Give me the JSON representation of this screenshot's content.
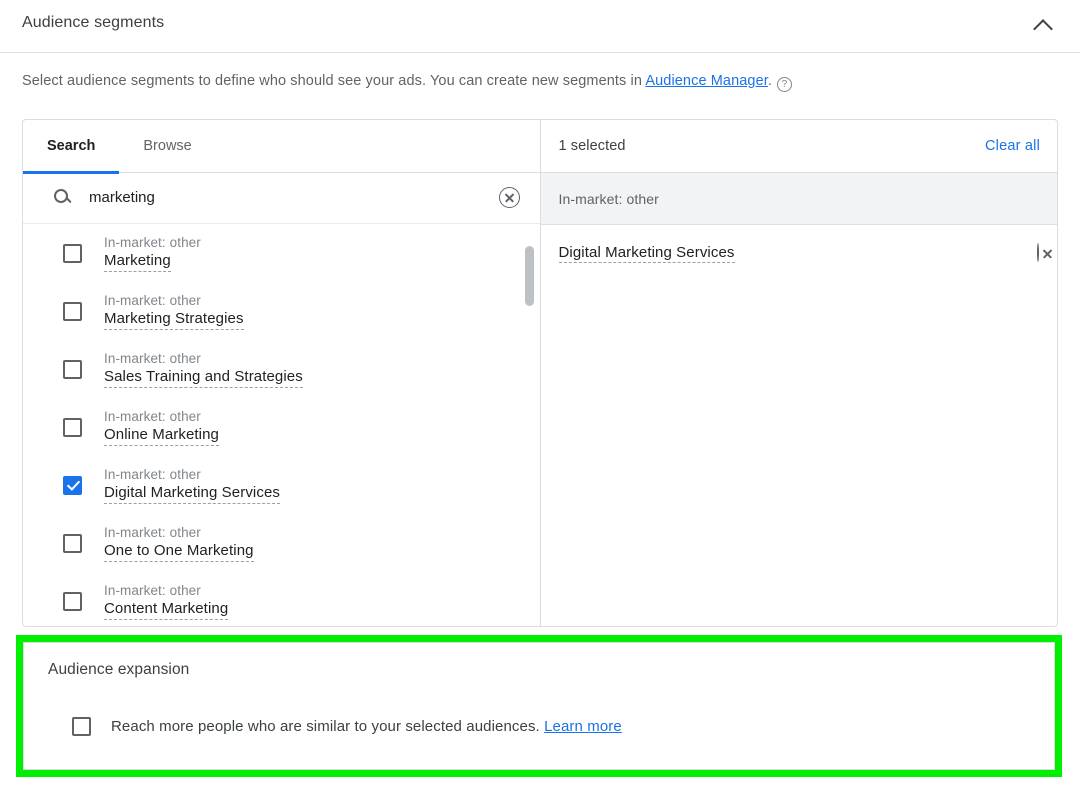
{
  "header": {
    "title": "Audience segments",
    "collapse_icon": "chevron-up-icon"
  },
  "description": {
    "text_before": "Select audience segments to define who should see your ads. You can create new segments in ",
    "link_label": "Audience Manager",
    "text_after": ".",
    "help_icon": "help-circle-icon",
    "help_glyph": "?"
  },
  "tabs": [
    {
      "label": "Search",
      "active": true
    },
    {
      "label": "Browse",
      "active": false
    }
  ],
  "search": {
    "value": "marketing",
    "placeholder": "Search",
    "icon": "search-icon",
    "clear_icon": "clear-circle-icon"
  },
  "results": [
    {
      "category": "In-market: other",
      "name": "Marketing",
      "checked": false
    },
    {
      "category": "In-market: other",
      "name": "Marketing Strategies",
      "checked": false
    },
    {
      "category": "In-market: other",
      "name": "Sales Training and Strategies",
      "checked": false
    },
    {
      "category": "In-market: other",
      "name": "Online Marketing",
      "checked": false
    },
    {
      "category": "In-market: other",
      "name": "Digital Marketing Services",
      "checked": true
    },
    {
      "category": "In-market: other",
      "name": "One to One Marketing",
      "checked": false
    },
    {
      "category": "In-market: other",
      "name": "Content Marketing",
      "checked": false
    }
  ],
  "selected_panel": {
    "count_label": "1 selected",
    "clear_all_label": "Clear all",
    "group_label": "In-market: other",
    "items": [
      {
        "name": "Digital Marketing Services",
        "remove_icon": "remove-circle-icon"
      }
    ]
  },
  "audience_expansion": {
    "title": "Audience expansion",
    "checkbox_checked": false,
    "text": "Reach more people who are similar to your selected audiences.",
    "link_label": "Learn more"
  },
  "colors": {
    "accent_blue": "#1a73e8",
    "highlight_green": "#00ee00",
    "text_primary": "#202124",
    "text_secondary": "#5f6368",
    "border": "#dadce0",
    "group_bg": "#f1f3f4"
  }
}
